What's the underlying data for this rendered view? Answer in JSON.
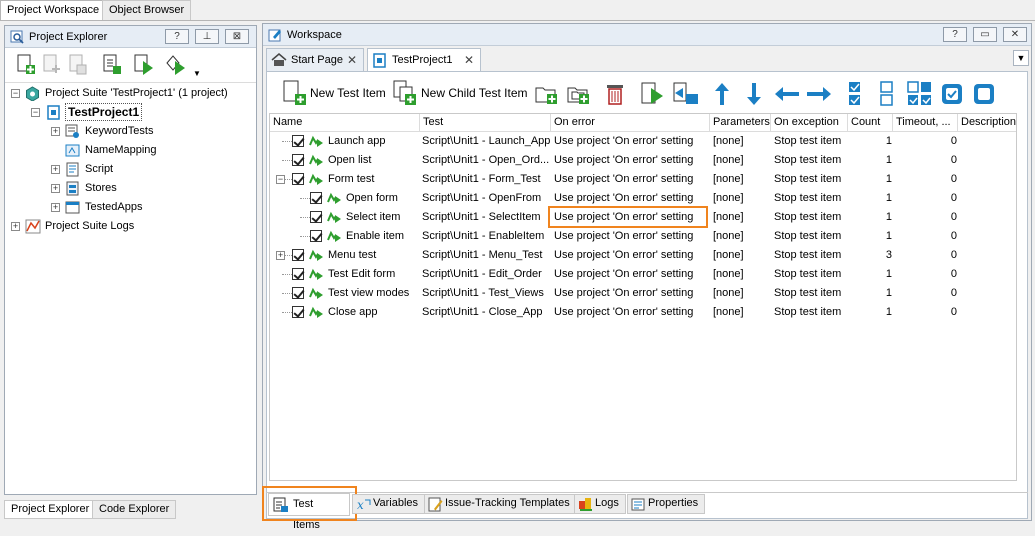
{
  "top_tabs": [
    "Project Workspace",
    "Object Browser"
  ],
  "explorer": {
    "title": "Project Explorer",
    "header_buttons": [
      "?",
      "⊥",
      "⊠"
    ],
    "tree": [
      {
        "label": "Project Suite 'TestProject1' (1 project)",
        "icon": "project-suite-icon",
        "expander": "minus"
      },
      {
        "label": "TestProject1",
        "icon": "project-icon",
        "expander": "minus"
      },
      {
        "label": "KeywordTests",
        "icon": "keyword-tests-icon",
        "expander": "plus"
      },
      {
        "label": "NameMapping",
        "icon": "name-mapping-icon",
        "expander": ""
      },
      {
        "label": "Script",
        "icon": "script-icon",
        "expander": "plus"
      },
      {
        "label": "Stores",
        "icon": "stores-icon",
        "expander": "plus"
      },
      {
        "label": "TestedApps",
        "icon": "tested-apps-icon",
        "expander": "plus"
      },
      {
        "label": "Project Suite Logs",
        "icon": "logs-icon",
        "expander": "plus"
      }
    ],
    "bottom_tabs": [
      "Project Explorer",
      "Code Explorer"
    ]
  },
  "workspace": {
    "title": "Workspace",
    "doc_tabs": [
      {
        "label": "Start Page",
        "icon": "home-icon"
      },
      {
        "label": "TestProject1",
        "icon": "project-icon"
      }
    ],
    "toolbar": {
      "new_test_item": "New Test Item",
      "new_child_test_item": "New Child Test Item"
    },
    "columns": [
      "Name",
      "Test",
      "On error",
      "Parameters",
      "On exception",
      "Count",
      "Timeout, ...",
      "Description"
    ],
    "rows": [
      {
        "name": "Launch app",
        "test": "Script\\Unit1 - Launch_App",
        "on_error": "Use project 'On error' setting",
        "params": "[none]",
        "on_exception": "Stop test item",
        "count": "1",
        "timeout": "0",
        "level": 0,
        "expander": ""
      },
      {
        "name": "Open list",
        "test": "Script\\Unit1 - Open_Ord...",
        "on_error": "Use project 'On error' setting",
        "params": "[none]",
        "on_exception": "Stop test item",
        "count": "1",
        "timeout": "0",
        "level": 0,
        "expander": ""
      },
      {
        "name": "Form test",
        "test": "Script\\Unit1 - Form_Test",
        "on_error": "Use project 'On error' setting",
        "params": "[none]",
        "on_exception": "Stop test item",
        "count": "1",
        "timeout": "0",
        "level": 0,
        "expander": "minus"
      },
      {
        "name": "Open form",
        "test": "Script\\Unit1 - OpenFrom",
        "on_error": "Use project 'On error' setting",
        "params": "[none]",
        "on_exception": "Stop test item",
        "count": "1",
        "timeout": "0",
        "level": 1,
        "expander": ""
      },
      {
        "name": "Select item",
        "test": "Script\\Unit1 - SelectItem",
        "on_error": "Use project 'On error' setting",
        "params": "[none]",
        "on_exception": "Stop test item",
        "count": "1",
        "timeout": "0",
        "level": 1,
        "expander": ""
      },
      {
        "name": "Enable item",
        "test": "Script\\Unit1 - EnableItem",
        "on_error": "Use project 'On error' setting",
        "params": "[none]",
        "on_exception": "Stop test item",
        "count": "1",
        "timeout": "0",
        "level": 1,
        "expander": ""
      },
      {
        "name": "Menu test",
        "test": "Script\\Unit1 - Menu_Test",
        "on_error": "Use project 'On error' setting",
        "params": "[none]",
        "on_exception": "Stop test item",
        "count": "3",
        "timeout": "0",
        "level": 0,
        "expander": "plus"
      },
      {
        "name": "Test Edit form",
        "test": "Script\\Unit1 - Edit_Order",
        "on_error": "Use project 'On error' setting",
        "params": "[none]",
        "on_exception": "Stop test item",
        "count": "1",
        "timeout": "0",
        "level": 0,
        "expander": ""
      },
      {
        "name": "Test view modes",
        "test": "Script\\Unit1 - Test_Views",
        "on_error": "Use project 'On error' setting",
        "params": "[none]",
        "on_exception": "Stop test item",
        "count": "1",
        "timeout": "0",
        "level": 0,
        "expander": ""
      },
      {
        "name": "Close app",
        "test": "Script\\Unit1 - Close_App",
        "on_error": "Use project 'On error' setting",
        "params": "[none]",
        "on_exception": "Stop test item",
        "count": "1",
        "timeout": "0",
        "level": 0,
        "expander": ""
      }
    ],
    "bottom_tabs": [
      {
        "label": "Test Items",
        "icon": "test-items-icon"
      },
      {
        "label": "Variables",
        "icon": "variables-icon"
      },
      {
        "label": "Issue-Tracking Templates",
        "icon": "issue-tracking-icon"
      },
      {
        "label": "Logs",
        "icon": "logs-icon"
      },
      {
        "label": "Properties",
        "icon": "properties-icon"
      }
    ]
  },
  "colors": {
    "highlight": "#f0841e",
    "accent_blue": "#1b7fc4",
    "accent_green": "#2e9e2e"
  }
}
